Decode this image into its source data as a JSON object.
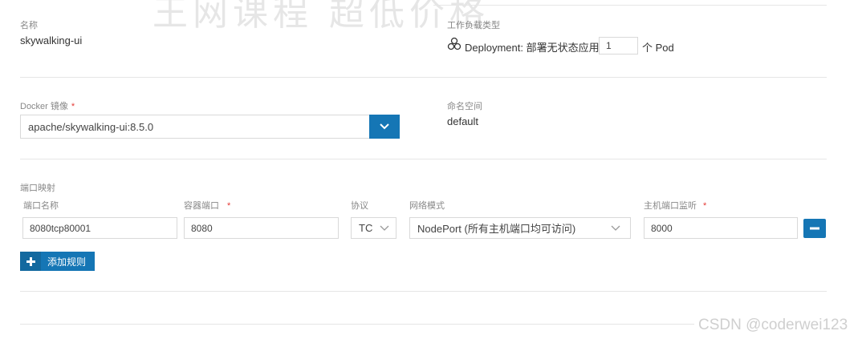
{
  "watermark": {
    "top": "王网课程 超低价格",
    "bottom_right": "CSDN @coderwei123"
  },
  "name_section": {
    "label": "名称",
    "value": "skywalking-ui"
  },
  "workload": {
    "label": "工作负载类型",
    "type_text": "Deployment: 部署无状态应用",
    "replicas": "1",
    "unit": "个 Pod"
  },
  "docker": {
    "label": "Docker 镜像",
    "required": "*",
    "value": "apache/skywalking-ui:8.5.0"
  },
  "namespace": {
    "label": "命名空间",
    "value": "default"
  },
  "ports": {
    "section_label": "端口映射",
    "headers": {
      "name": "端口名称",
      "container_port": "容器端口",
      "protocol": "协议",
      "network_mode": "网络模式",
      "host_port": "主机端口监听"
    },
    "required": "*",
    "row": {
      "name": "8080tcp80001",
      "container_port": "8080",
      "protocol": "TCP",
      "network_mode": "NodePort (所有主机端口均可访问)",
      "host_port": "8000"
    },
    "remove_icon": "minus-icon",
    "add_label": "添加规则",
    "add_icon": "plus-icon"
  },
  "colors": {
    "primary": "#1576b5",
    "required": "#e53935",
    "border": "#d9d9d9"
  }
}
